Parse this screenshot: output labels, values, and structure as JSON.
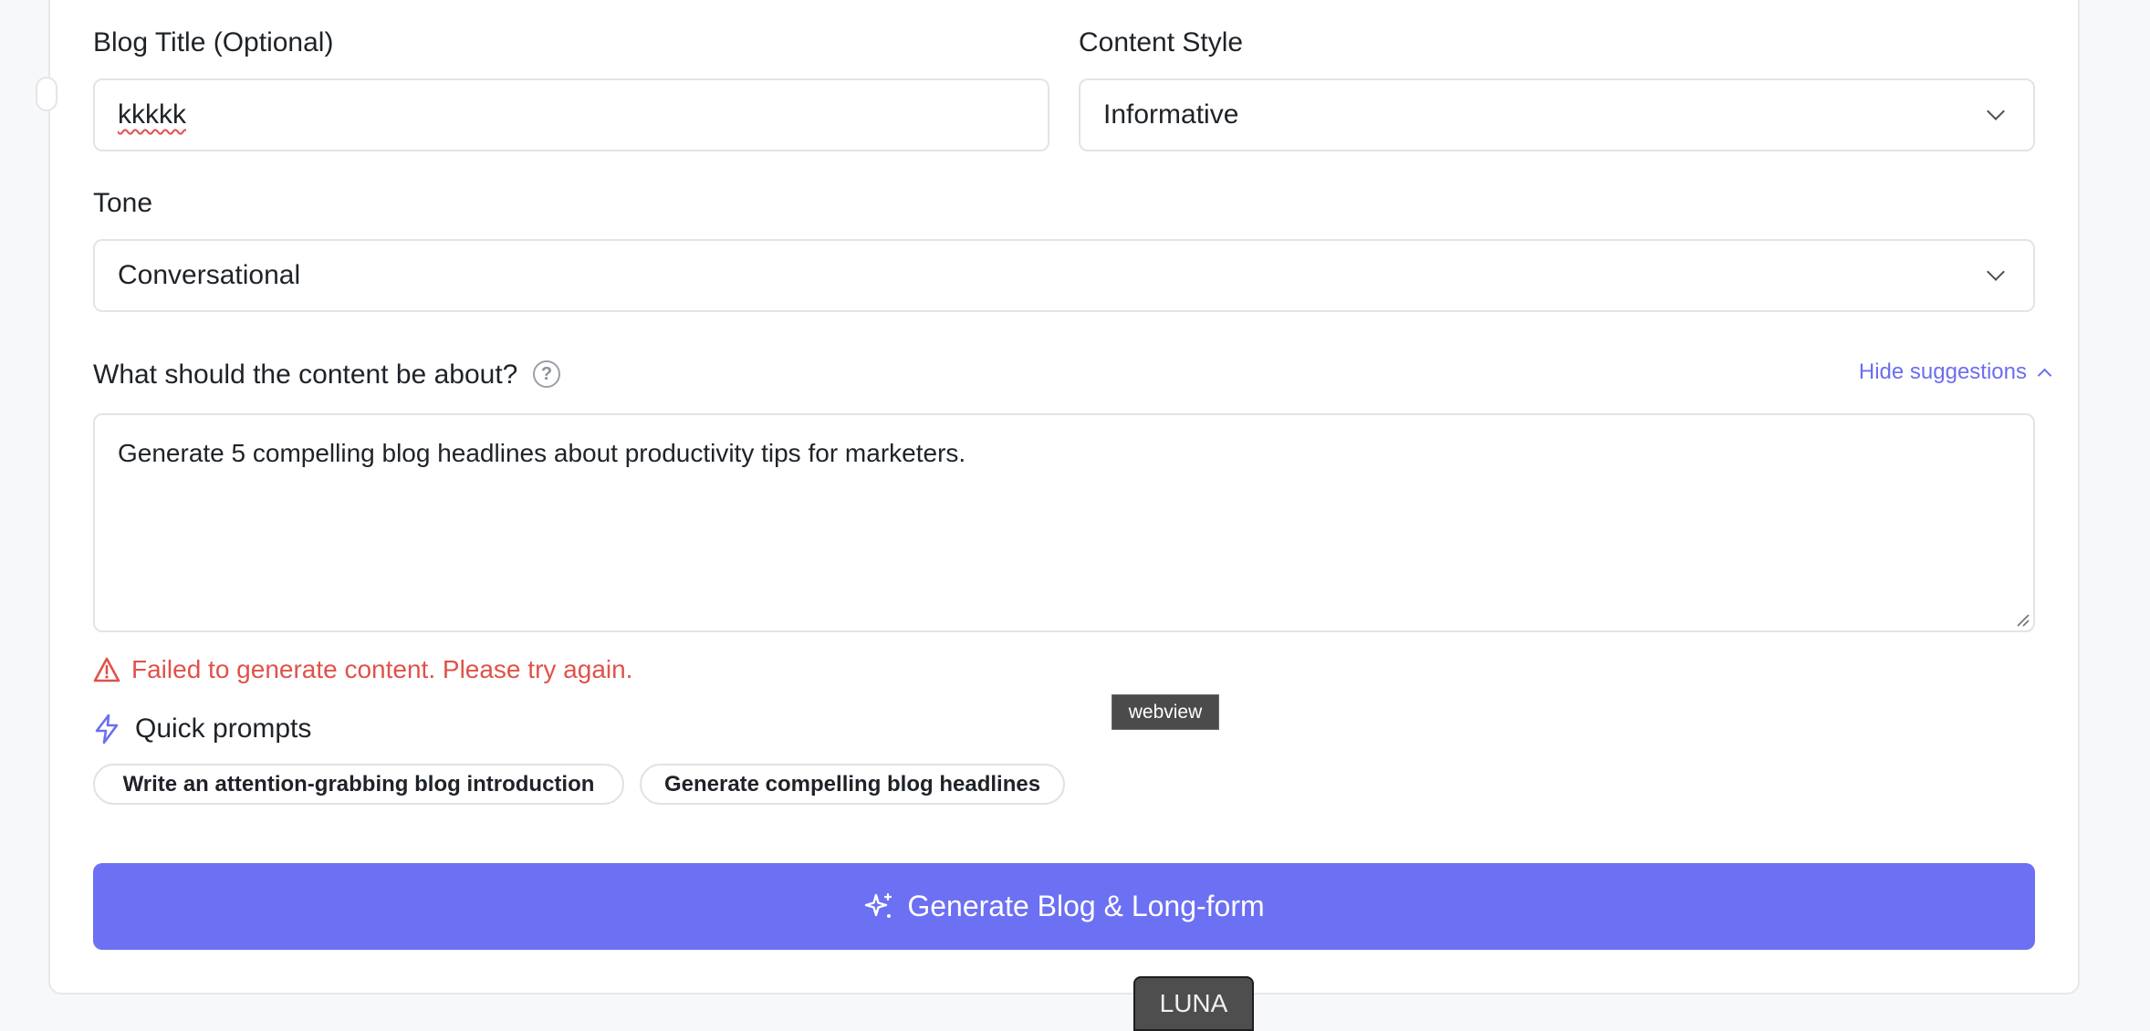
{
  "form": {
    "blog_title_label": "Blog Title (Optional)",
    "blog_title_value": "kkkkk",
    "content_style_label": "Content Style",
    "content_style_value": "Informative",
    "tone_label": "Tone",
    "tone_value": "Conversational",
    "content_about_label": "What should the content be about?",
    "help_glyph": "?",
    "hide_suggestions": "Hide suggestions",
    "content_about_value": "Generate 5 compelling blog headlines about productivity tips for marketers."
  },
  "error": {
    "message": "Failed to generate content. Please try again.",
    "color": "#e0524a"
  },
  "quick_prompts": {
    "title": "Quick prompts",
    "chips": [
      "Write an attention-grabbing blog introduction",
      "Generate compelling blog headlines"
    ]
  },
  "generate_button": {
    "label": "Generate Blog & Long-form",
    "color": "#6c70f2"
  },
  "overlay": {
    "tooltip": "webview",
    "tab": "LUNA"
  },
  "icons": {
    "help": "question-circle-icon",
    "chevron": "chevron-down-icon",
    "chevron_up": "chevron-up-icon",
    "warning": "warning-triangle-icon",
    "bolt": "lightning-bolt-icon",
    "sparkle": "sparkle-icon"
  }
}
